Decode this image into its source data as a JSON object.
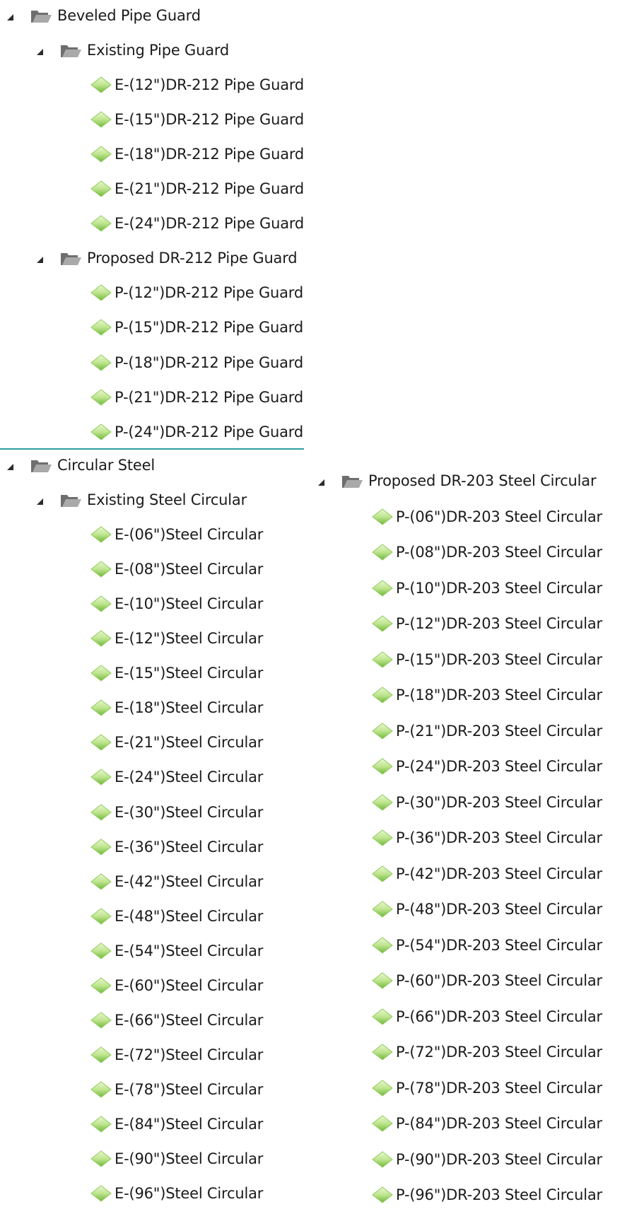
{
  "tree": {
    "groups": [
      {
        "label": "Beveled Pipe Guard",
        "children": [
          {
            "label": "Existing Pipe Guard",
            "items": [
              "E-(12\")DR-212 Pipe Guard",
              "E-(15\")DR-212 Pipe Guard",
              "E-(18\")DR-212 Pipe Guard",
              "E-(21\")DR-212 Pipe Guard",
              "E-(24\")DR-212 Pipe Guard"
            ]
          },
          {
            "label": "Proposed DR-212 Pipe Guard",
            "items": [
              "P-(12\")DR-212 Pipe Guard",
              "P-(15\")DR-212 Pipe Guard",
              "P-(18\")DR-212 Pipe Guard",
              "P-(21\")DR-212 Pipe Guard",
              "P-(24\")DR-212 Pipe Guard"
            ]
          }
        ]
      },
      {
        "label": "Circular Steel",
        "children": [
          {
            "label": "Existing Steel Circular",
            "items": [
              "E-(06\")Steel Circular",
              "E-(08\")Steel Circular",
              "E-(10\")Steel Circular",
              "E-(12\")Steel Circular",
              "E-(15\")Steel Circular",
              "E-(18\")Steel Circular",
              "E-(21\")Steel Circular",
              "E-(24\")Steel Circular",
              "E-(30\")Steel Circular",
              "E-(36\")Steel Circular",
              "E-(42\")Steel Circular",
              "E-(48\")Steel Circular",
              "E-(54\")Steel Circular",
              "E-(60\")Steel Circular",
              "E-(66\")Steel Circular",
              "E-(72\")Steel Circular",
              "E-(78\")Steel Circular",
              "E-(84\")Steel Circular",
              "E-(90\")Steel Circular",
              "E-(96\")Steel Circular"
            ]
          },
          {
            "label": "Proposed DR-203 Steel Circular",
            "items": [
              "P-(06\")DR-203 Steel Circular",
              "P-(08\")DR-203 Steel Circular",
              "P-(10\")DR-203 Steel Circular",
              "P-(12\")DR-203 Steel Circular",
              "P-(15\")DR-203 Steel Circular",
              "P-(18\")DR-203 Steel Circular",
              "P-(21\")DR-203 Steel Circular",
              "P-(24\")DR-203 Steel Circular",
              "P-(30\")DR-203 Steel Circular",
              "P-(36\")DR-203 Steel Circular",
              "P-(42\")DR-203 Steel Circular",
              "P-(48\")DR-203 Steel Circular",
              "P-(54\")DR-203 Steel Circular",
              "P-(60\")DR-203 Steel Circular",
              "P-(66\")DR-203 Steel Circular",
              "P-(72\")DR-203 Steel Circular",
              "P-(78\")DR-203 Steel Circular",
              "P-(84\")DR-203 Steel Circular",
              "P-(90\")DR-203 Steel Circular",
              "P-(96\")DR-203 Steel Circular"
            ]
          }
        ]
      }
    ]
  },
  "icons": {
    "expander": "expanded-triangle-icon",
    "folder": "open-folder-icon",
    "item": "green-diamond-icon"
  },
  "colors": {
    "divider": "#2c9e9f",
    "diamond_light": "#d9f2b4",
    "diamond_dark": "#7cc242",
    "folder": "#8a8a8a"
  }
}
